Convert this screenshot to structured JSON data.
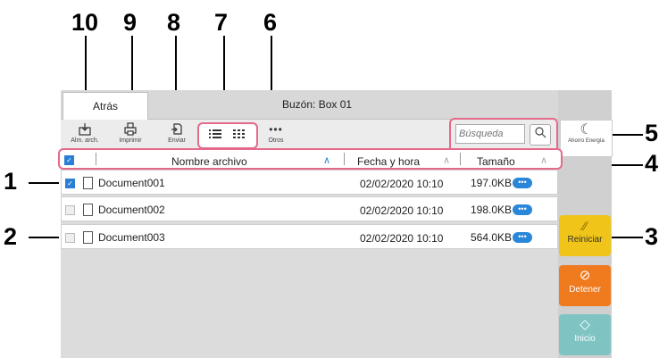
{
  "callouts": {
    "c1": "1",
    "c2": "2",
    "c3": "3",
    "c4": "4",
    "c5": "5",
    "c6": "6",
    "c7": "7",
    "c8": "8",
    "c9": "9",
    "c10": "10"
  },
  "header": {
    "back_label": "Atrás",
    "title": "Buzón: Box 01"
  },
  "toolbar": {
    "store_label": "Alm. arch.",
    "print_label": "Imprimir",
    "send_label": "Enviar",
    "others_label": "Otros",
    "others_icon": "•••",
    "list_view_icon": "list-view-icon",
    "thumb_view_icon": "thumbnail-view-icon"
  },
  "search": {
    "placeholder": "Búsqueda"
  },
  "columns": {
    "name": "Nombre archivo",
    "date": "Fecha y hora",
    "size": "Tamaño"
  },
  "rows": [
    {
      "name": "Document001",
      "date": "02/02/2020 10:10",
      "size": "197.0KB",
      "checked": true
    },
    {
      "name": "Document002",
      "date": "02/02/2020 10:10",
      "size": "198.0KB",
      "checked": false
    },
    {
      "name": "Document003",
      "date": "02/02/2020 10:10",
      "size": "564.0KB",
      "checked": false
    }
  ],
  "side": {
    "energy_label": "Ahorro Energía",
    "reset_label": "Reiniciar",
    "stop_label": "Detener",
    "start_label": "Inicio"
  },
  "colors": {
    "highlight": "#e46a8a",
    "accent_blue": "#2a86d8",
    "reset_yellow": "#f0c419",
    "stop_orange": "#f07a1e",
    "start_teal": "#7fc3c3"
  }
}
